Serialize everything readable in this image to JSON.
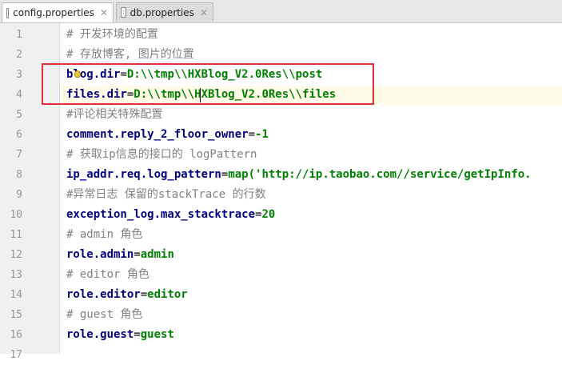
{
  "tabs": [
    {
      "label": "config.properties",
      "active": true
    },
    {
      "label": "db.properties",
      "active": false
    }
  ],
  "lines": [
    {
      "n": "1",
      "type": "comment",
      "text": "# 开发环境的配置"
    },
    {
      "n": "2",
      "type": "comment",
      "text": "# 存放博客, 图片的位置"
    },
    {
      "n": "3",
      "type": "property",
      "key": "blog.dir",
      "value": "D:\\\\tmp\\\\HXBlog_V2.0Res\\\\post"
    },
    {
      "n": "4",
      "type": "property",
      "key": "files.dir",
      "value": "D:\\\\tmp\\\\HXBlog_V2.0Res\\\\files"
    },
    {
      "n": "5",
      "type": "comment",
      "text": "#评论相关特殊配置"
    },
    {
      "n": "6",
      "type": "property",
      "key": "comment.reply_2_floor_owner",
      "value": "-1"
    },
    {
      "n": "7",
      "type": "comment",
      "text": "# 获取ip信息的接口的 logPattern"
    },
    {
      "n": "8",
      "type": "property",
      "key": "ip_addr.req.log_pattern",
      "value": "map('http://ip.taobao.com//service/getIpInfo."
    },
    {
      "n": "9",
      "type": "comment",
      "text": "#异常日志 保留的stackTrace 的行数"
    },
    {
      "n": "10",
      "type": "property",
      "key": "exception_log.max_stacktrace",
      "value": "20"
    },
    {
      "n": "11",
      "type": "comment",
      "text": "# admin 角色"
    },
    {
      "n": "12",
      "type": "property",
      "key": "role.admin",
      "value": "admin"
    },
    {
      "n": "13",
      "type": "comment",
      "text": "# editor 角色"
    },
    {
      "n": "14",
      "type": "property",
      "key": "role.editor",
      "value": "editor"
    },
    {
      "n": "15",
      "type": "comment",
      "text": "# guest 角色"
    },
    {
      "n": "16",
      "type": "property",
      "key": "role.guest",
      "value": "guest"
    },
    {
      "n": "17",
      "type": "empty",
      "text": ""
    }
  ],
  "colors": {
    "comment": "#808080",
    "key": "#000080",
    "value": "#008000",
    "highlight_box": "#e0303a"
  }
}
